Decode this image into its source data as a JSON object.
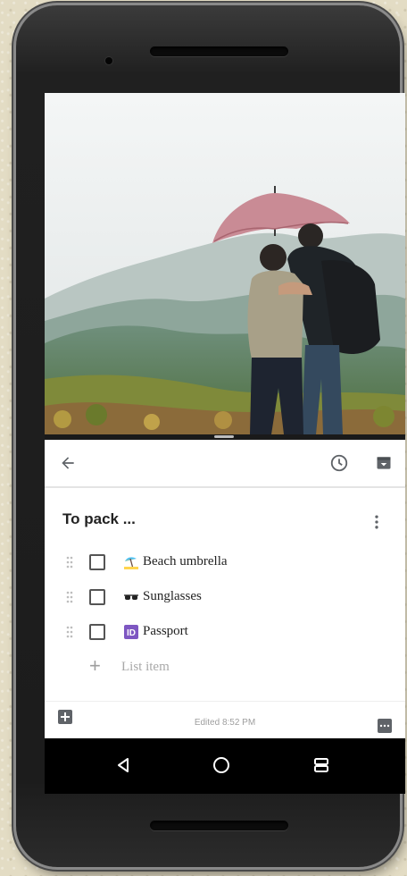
{
  "photo": {
    "description_icon": "photo-couple-umbrella-mountains"
  },
  "toolbar": {
    "back_icon": "arrow-left-icon",
    "reminder_icon": "clock-icon",
    "archive_icon": "archive-icon"
  },
  "note": {
    "title": "To pack ...",
    "items": [
      {
        "emoji_icon": "beach-umbrella-icon",
        "label": "Beach umbrella",
        "checked": false
      },
      {
        "emoji_icon": "sunglasses-icon",
        "label": "Sunglasses",
        "checked": false
      },
      {
        "emoji_icon": "id-icon",
        "label": "Passport",
        "checked": false
      }
    ],
    "add_placeholder": "List item"
  },
  "bottombar": {
    "edited": "Edited 8:52 PM"
  },
  "colors": {
    "accent_purple": "#7e57c2",
    "toolbar_icon": "#5f6368"
  }
}
